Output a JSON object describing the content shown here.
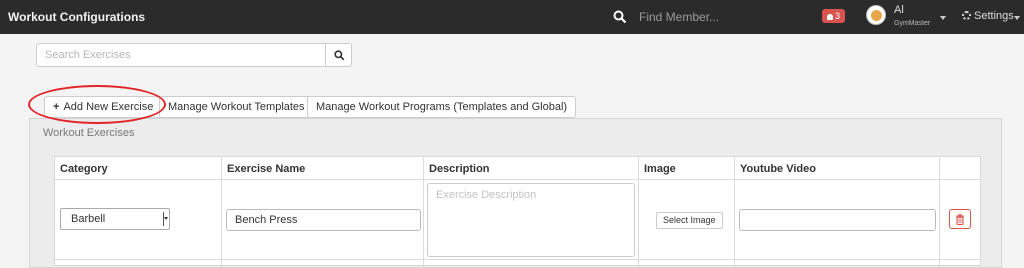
{
  "app": {
    "title": "Workout Configurations"
  },
  "header": {
    "find_placeholder": "Find Member...",
    "notification_count": "3",
    "user_name": "Al",
    "user_org": "GymMaster",
    "settings_label": "Settings"
  },
  "search": {
    "placeholder": "Search Exercises"
  },
  "tabs": [
    {
      "label": "Add New Exercise",
      "icon": "plus-icon"
    },
    {
      "label": "Manage Workout Templates"
    },
    {
      "label": "Manage Workout Programs (Templates and Global)"
    }
  ],
  "panel": {
    "title": "Workout Exercises"
  },
  "table": {
    "columns": [
      "Category",
      "Exercise Name",
      "Description",
      "Image",
      "Youtube Video"
    ],
    "row": {
      "category": "Barbell",
      "exercise_name": "Bench Press",
      "description_placeholder": "Exercise Description",
      "image_button": "Select Image",
      "youtube": ""
    }
  },
  "colors": {
    "topbar": "#2b2b2b",
    "badge": "#d9534f",
    "highlight": "#e0252a",
    "delete": "#d9534f"
  }
}
